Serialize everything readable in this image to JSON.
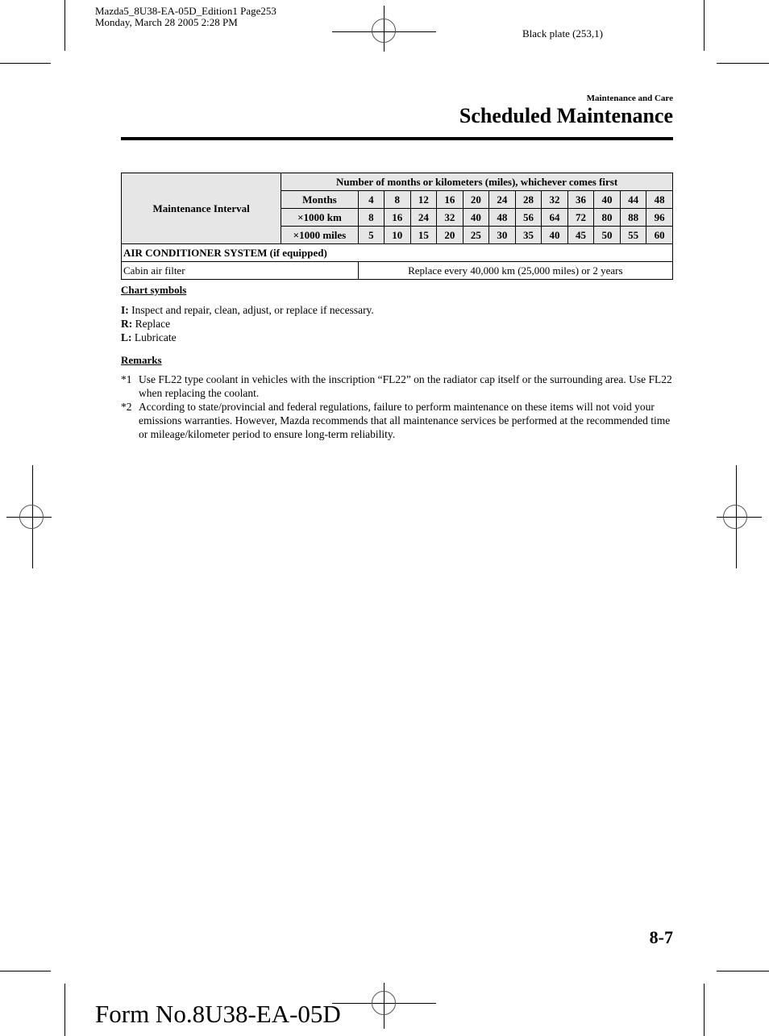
{
  "print_info": {
    "line1": "Mazda5_8U38-EA-05D_Edition1 Page253",
    "line2": "Monday, March 28 2005 2:28 PM",
    "plate": "Black plate (253,1)"
  },
  "header": {
    "section": "Maintenance and Care",
    "title": "Scheduled Maintenance"
  },
  "table": {
    "interval_label": "Maintenance Interval",
    "span_header": "Number of months or kilometers (miles), whichever comes first",
    "rows": [
      {
        "label": "Months",
        "values": [
          "4",
          "8",
          "12",
          "16",
          "20",
          "24",
          "28",
          "32",
          "36",
          "40",
          "44",
          "48"
        ]
      },
      {
        "label": "×1000 km",
        "values": [
          "8",
          "16",
          "24",
          "32",
          "40",
          "48",
          "56",
          "64",
          "72",
          "80",
          "88",
          "96"
        ]
      },
      {
        "label": "×1000 miles",
        "values": [
          "5",
          "10",
          "15",
          "20",
          "25",
          "30",
          "35",
          "40",
          "45",
          "50",
          "55",
          "60"
        ]
      }
    ],
    "section": "AIR CONDITIONER SYSTEM (if equipped)",
    "items": [
      {
        "name": "Cabin air filter",
        "schedule": "Replace every 40,000 km (25,000 miles) or 2 years"
      }
    ]
  },
  "chart_symbols": {
    "heading": "Chart symbols",
    "items": [
      {
        "key": "I:",
        "text": " Inspect and repair, clean, adjust, or replace if necessary."
      },
      {
        "key": "R:",
        "text": " Replace"
      },
      {
        "key": "L:",
        "text": " Lubricate"
      }
    ]
  },
  "remarks": {
    "heading": "Remarks",
    "items": [
      {
        "mark": "*1",
        "text": "Use FL22 type coolant in vehicles with the inscription “FL22” on the radiator cap itself or the surrounding area. Use FL22 when replacing the coolant."
      },
      {
        "mark": "*2",
        "text": "According to state/provincial and federal regulations, failure to perform maintenance on these items will not void your emissions warranties. However, Mazda recommends that all maintenance services be performed at the recommended time or mileage/kilometer period to ensure long-term reliability."
      }
    ]
  },
  "footer": {
    "page_number": "8-7",
    "form_number": "Form No.8U38-EA-05D"
  }
}
